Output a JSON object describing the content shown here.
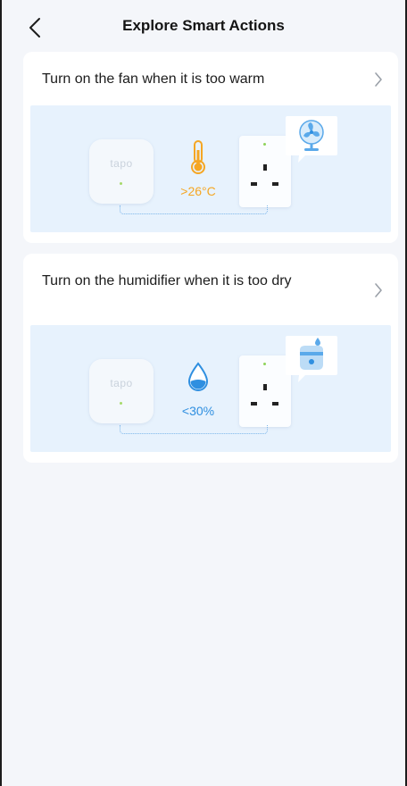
{
  "header": {
    "title": "Explore Smart Actions"
  },
  "cards": [
    {
      "title": "Turn on the fan when it is too warm",
      "sensor_logo": "tapo",
      "condition_icon": "thermometer-icon",
      "condition_value": ">26°C",
      "condition_color": "#f5a623",
      "device_icon": "fan-icon"
    },
    {
      "title": "Turn on the humidifier when it is too dry",
      "sensor_logo": "tapo",
      "condition_icon": "water-drop-icon",
      "condition_value": "<30%",
      "condition_color": "#2f8fe0",
      "device_icon": "humidifier-icon"
    }
  ],
  "colors": {
    "background": "#f4f6fa",
    "card": "#ffffff",
    "illustration_bg": "#e7f2fd",
    "accent_blue": "#2f8fe0",
    "accent_orange": "#f5a623"
  }
}
